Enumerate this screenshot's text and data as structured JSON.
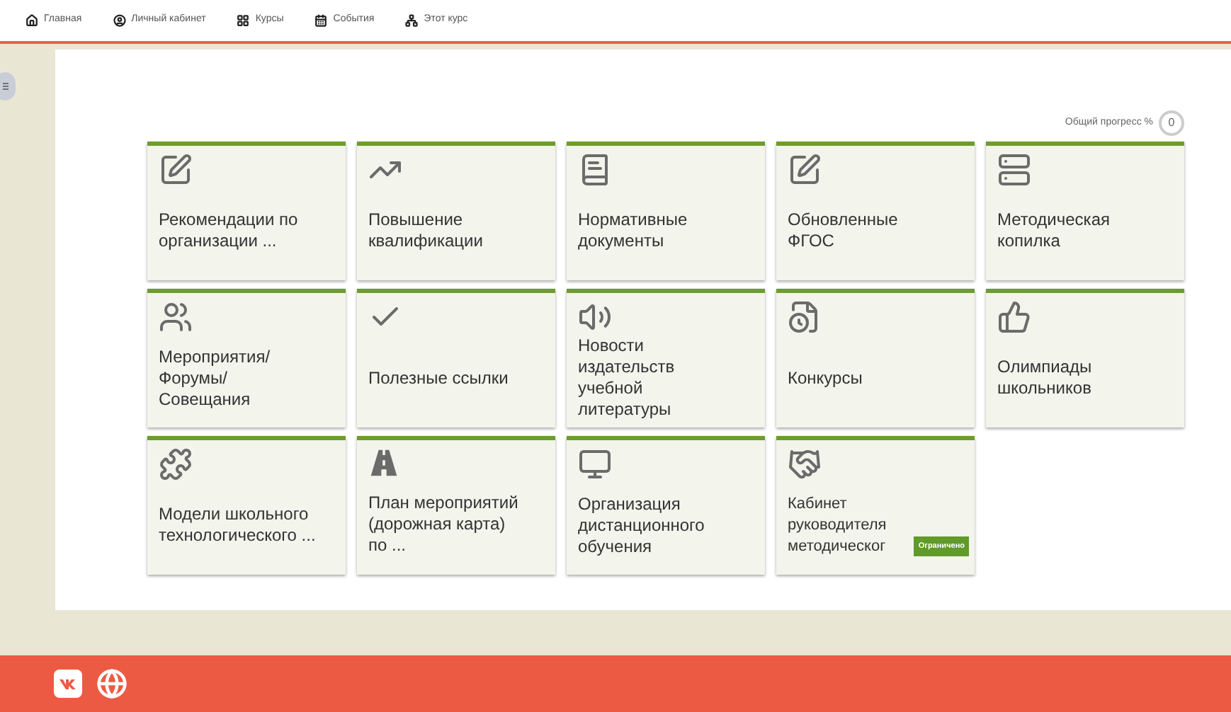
{
  "nav": [
    {
      "label": "Главная"
    },
    {
      "label": "Личный кабинет"
    },
    {
      "label": "Курсы"
    },
    {
      "label": "События"
    },
    {
      "label": "Этот курс"
    }
  ],
  "progress": {
    "label": "Общий прогресс %",
    "value": "0"
  },
  "tiles": [
    {
      "title": "Рекомендации по организации ..."
    },
    {
      "title": "Повышение квалификации"
    },
    {
      "title": "Нормативные документы"
    },
    {
      "title": "Обновленные ФГОС"
    },
    {
      "title": "Методическая копилка"
    },
    {
      "title": "Мероприятия/ Форумы/ Совещания"
    },
    {
      "title": "Полезные ссылки"
    },
    {
      "title": "Новости издательств учебной литературы"
    },
    {
      "title": "Конкурсы"
    },
    {
      "title": "Олимпиады школьников"
    },
    {
      "title": "Модели школьного технологического ..."
    },
    {
      "title": "План мероприятий (дорожная карта) по ..."
    },
    {
      "title": "Организация дистанционного обучения"
    },
    {
      "title": "Кабинет руководителя методическог",
      "badge": "Ограничено"
    }
  ]
}
